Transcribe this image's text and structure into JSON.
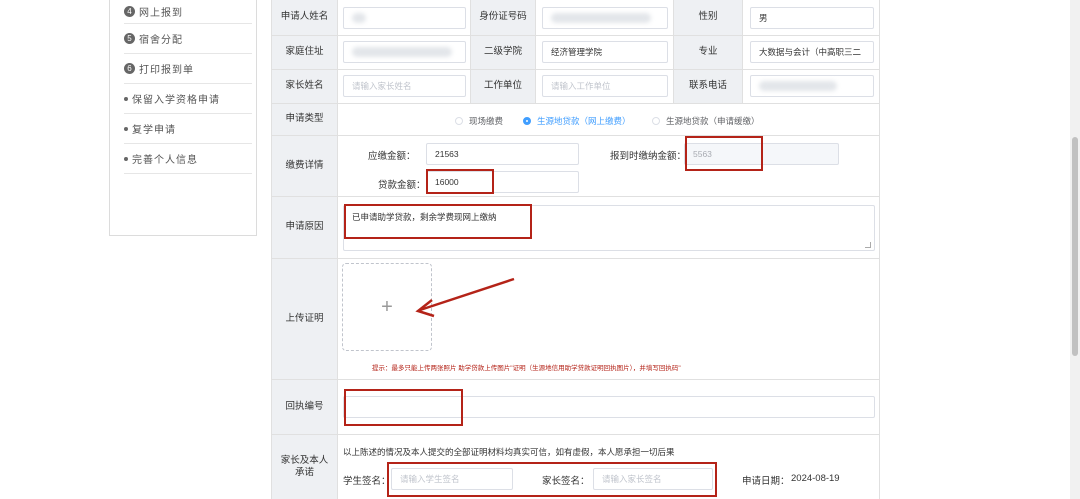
{
  "sidebar": {
    "items": [
      {
        "num": "4",
        "label": "网上报到"
      },
      {
        "num": "5",
        "label": "宿舍分配"
      },
      {
        "num": "6",
        "label": "打印报到单"
      },
      {
        "label": "保留入学资格申请"
      },
      {
        "label": "复学申请"
      },
      {
        "label": "完善个人信息"
      }
    ]
  },
  "form": {
    "applicant_name_label": "申请人姓名",
    "id_number_label": "身份证号码",
    "gender_label": "性别",
    "gender_value": "男",
    "address_label": "家庭住址",
    "college_label": "二级学院",
    "college_value": "经济管理学院",
    "major_label": "专业",
    "major_value": "大数据与会计（中高职三二",
    "parent_name_label": "家长姓名",
    "parent_name_placeholder": "请输入家长姓名",
    "work_unit_label": "工作单位",
    "work_unit_placeholder": "请输入工作单位",
    "phone_label": "联系电话",
    "apply_type_label": "申请类型",
    "apply_type_options": [
      "现场缴费",
      "生源地贷款（网上缴费）",
      "生源地贷款（申请缓缴）"
    ],
    "apply_type_selected": "生源地贷款（网上缴费）",
    "payment_label": "缴费详情",
    "due_amount_label": "应缴金额：",
    "due_amount_value": "21563",
    "checkin_amount_label": "报到时缴纳金额：",
    "checkin_amount_value": "5563",
    "loan_amount_label": "贷款金额：",
    "loan_amount_value": "16000",
    "reason_label": "申请原因",
    "reason_value": "已申请助学贷款，剩余学费现网上缴纳",
    "upload_label": "上传证明",
    "upload_plus": "+",
    "upload_hint": "提示：最多只能上传两张照片 助学贷款上传图片\"证明（生源地信用助学贷款证明回执图片），并填写回执码\"",
    "receipt_label": "回执编号",
    "promise_label": "家长及本人承诺",
    "promise_text": "以上陈述的情况及本人提交的全部证明材料均真实可信，如有虚假，本人愿承担一切后果",
    "student_sign_label": "学生签名：",
    "student_sign_placeholder": "请输入学生签名",
    "parent_sign_label": "家长签名：",
    "parent_sign_placeholder": "请输入家长签名",
    "apply_date_label": "申请日期：",
    "apply_date_value": "2024-08-19"
  },
  "annotation_color": "#b42318",
  "accent_color": "#409eff"
}
